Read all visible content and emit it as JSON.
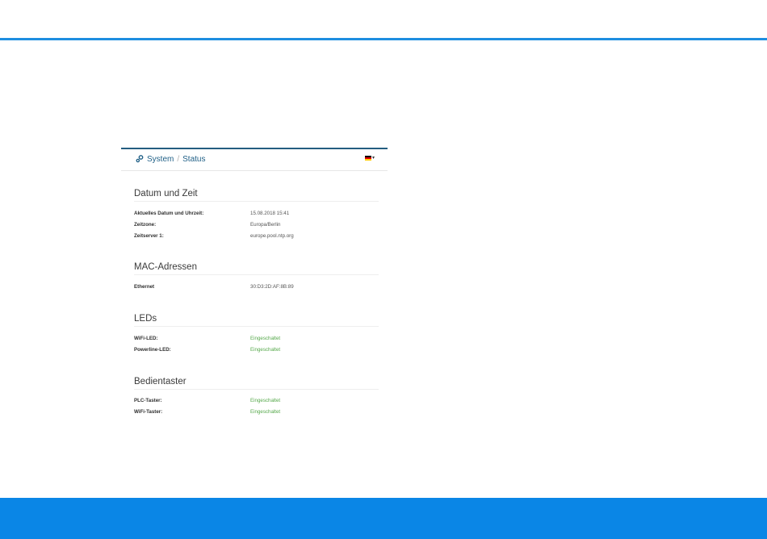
{
  "header": {
    "breadcrumb_root": "System",
    "breadcrumb_separator": "/",
    "breadcrumb_current": "Status",
    "language_flag": "de-flag-icon"
  },
  "colors": {
    "accent_blue": "#0a86e6",
    "top_rule": "#1e8ee0",
    "link": "#1f5f86",
    "status_on": "#55a84a"
  },
  "sections": {
    "datetime": {
      "title": "Datum und Zeit",
      "rows": [
        {
          "label": "Aktuelles Datum und Uhrzeit:",
          "value": "15.08.2018 15:41"
        },
        {
          "label": "Zeitzone:",
          "value": "Europa/Berlin"
        },
        {
          "label": "Zeitserver 1:",
          "value": "europe.pool.ntp.org"
        }
      ]
    },
    "mac": {
      "title": "MAC-Adressen",
      "rows": [
        {
          "label": "Ethernet",
          "value": "30:D3:2D:AF:8B:89"
        }
      ]
    },
    "leds": {
      "title": "LEDs",
      "rows": [
        {
          "label": "WiFi-LED:",
          "value": "Eingeschaltet"
        },
        {
          "label": "Powerline-LED:",
          "value": "Eingeschaltet"
        }
      ]
    },
    "buttons": {
      "title": "Bedientaster",
      "rows": [
        {
          "label": "PLC-Taster:",
          "value": "Eingeschaltet"
        },
        {
          "label": "WiFi-Taster:",
          "value": "Eingeschaltet"
        }
      ]
    }
  }
}
